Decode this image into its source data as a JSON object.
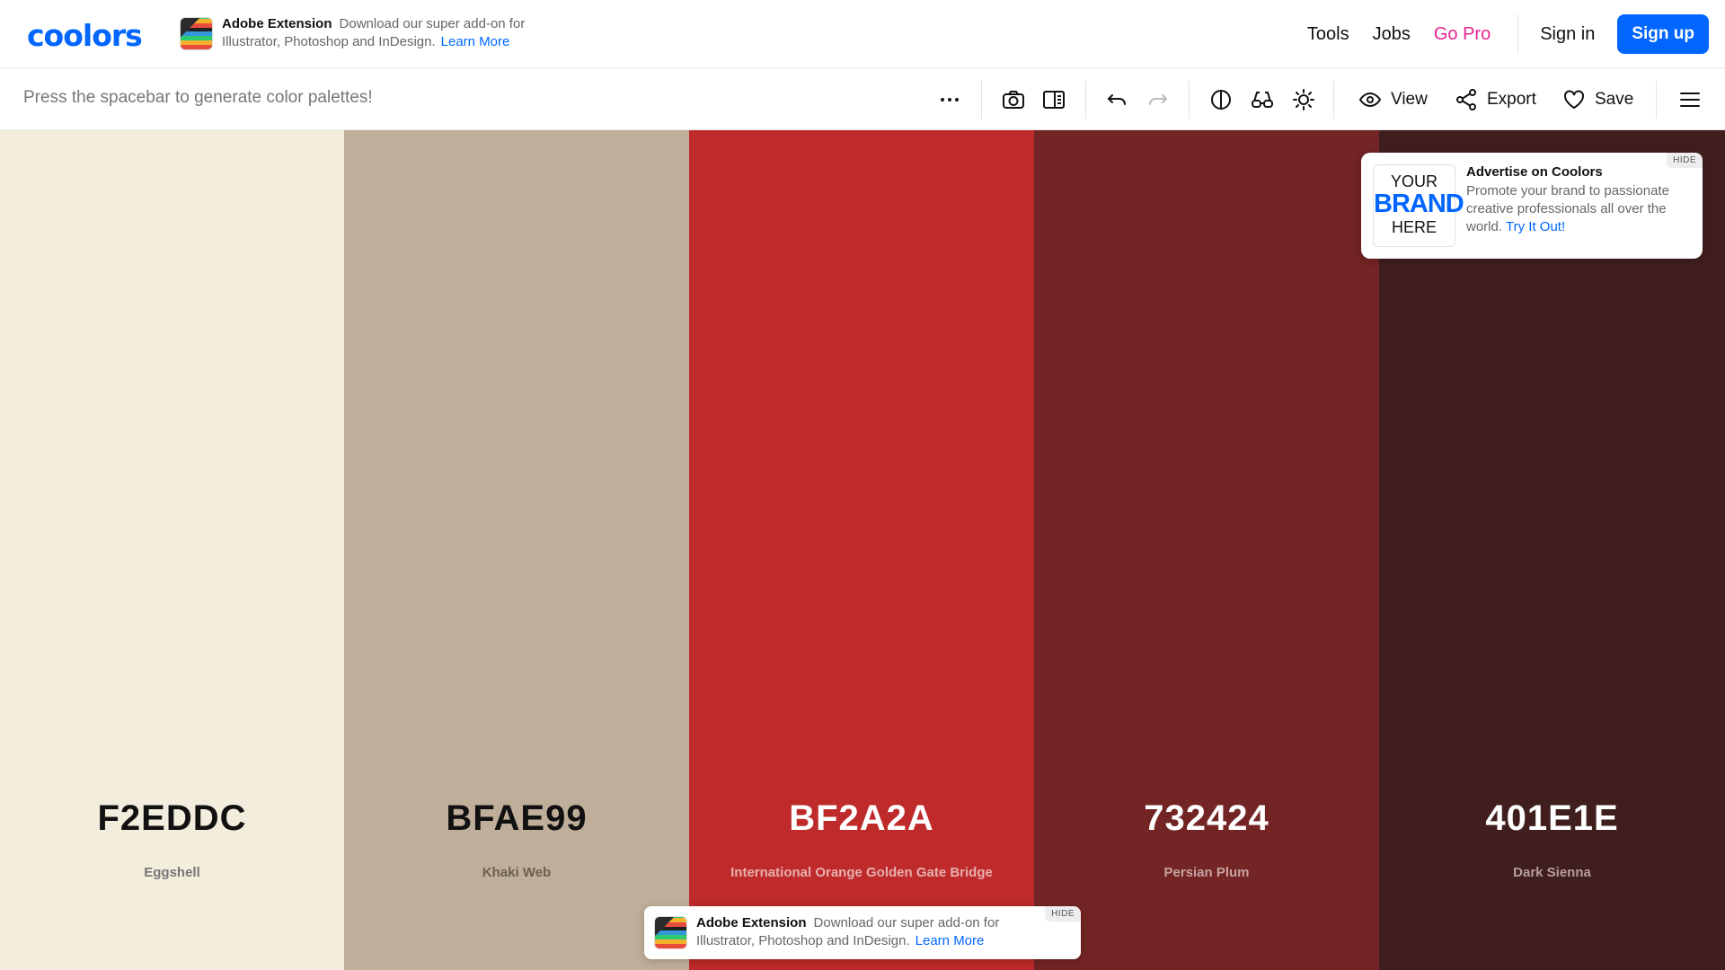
{
  "brand": {
    "logo": "coolors"
  },
  "promo": {
    "title": "Adobe Extension",
    "text": "Download our super add-on for Illustrator, Photoshop and InDesign.",
    "link": "Learn More"
  },
  "nav": {
    "links": [
      "Tools",
      "Jobs",
      "Go Pro"
    ],
    "signin": "Sign in",
    "signup": "Sign up"
  },
  "toolbar": {
    "hint": "Press the spacebar to generate color palettes!",
    "view_label": "View",
    "export_label": "Export",
    "save_label": "Save"
  },
  "palette": [
    {
      "hex": "F2EDDC",
      "name": "Eggshell",
      "color": "#F2EDDC",
      "text_color": "#111111",
      "name_color": "#777777"
    },
    {
      "hex": "BFAE99",
      "name": "Khaki Web",
      "color": "#BFAE99",
      "text_color": "#111111",
      "name_color": "#6b6152"
    },
    {
      "hex": "BF2A2A",
      "name": "International Orange Golden Gate Bridge",
      "color": "#BF2A2A",
      "text_color": "#ffffff",
      "name_color": "#e8b0b0"
    },
    {
      "hex": "732424",
      "name": "Persian Plum",
      "color": "#732424",
      "text_color": "#ffffff",
      "name_color": "#c9a2a2"
    },
    {
      "hex": "401E1E",
      "name": "Dark Sienna",
      "color": "#401E1E",
      "text_color": "#ffffff",
      "name_color": "#b69d9d"
    }
  ],
  "ad": {
    "brand_line1": "YOUR",
    "brand_line2": "BRAND",
    "brand_line3": "HERE",
    "title": "Advertise on Coolors",
    "body": "Promote your brand to passionate creative professionals all over the world.",
    "link": "Try It Out!",
    "hide": "HIDE"
  },
  "bottom_promo": {
    "title": "Adobe Extension",
    "text": "Download our super add-on for Illustrator, Photoshop and InDesign.",
    "link": "Learn More",
    "hide": "HIDE"
  },
  "colors": {
    "accent": "#0066ff",
    "pro": "#e8238f"
  }
}
